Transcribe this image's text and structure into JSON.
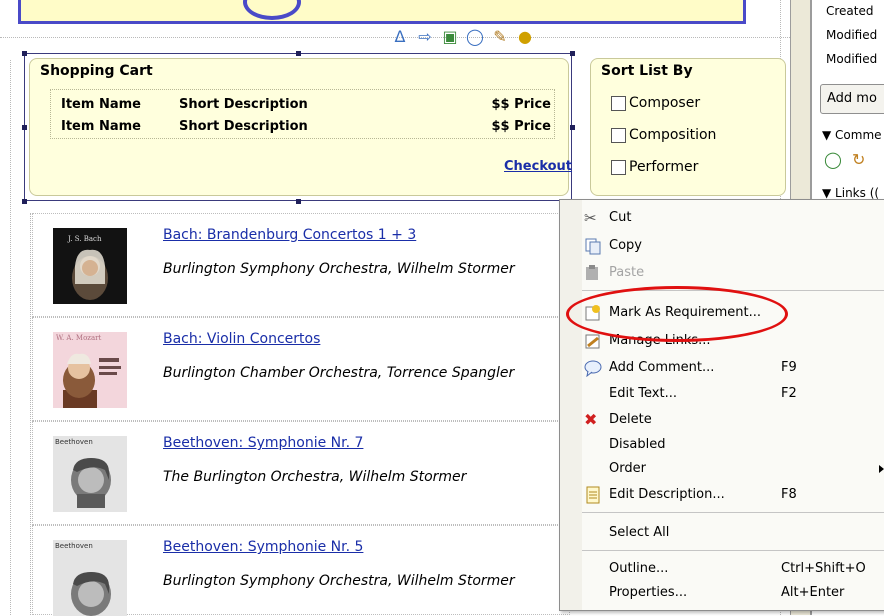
{
  "cart": {
    "title": "Shopping Cart",
    "rows": [
      {
        "name": "Item Name",
        "desc": "Short Description",
        "price": "$$ Price"
      },
      {
        "name": "Item Name",
        "desc": "Short Description",
        "price": "$$ Price"
      }
    ],
    "checkout": "Checkout"
  },
  "sort": {
    "title": "Sort List By",
    "options": [
      "Composer",
      "Composition",
      "Performer"
    ]
  },
  "products": [
    {
      "title": "Bach: Brandenburg Concertos 1 + 3",
      "subtitle": "Burlington Symphony Orchestra, Wilhelm Stormer",
      "thumb_caption": "J. S. Bach"
    },
    {
      "title": "Bach: Violin Concertos",
      "subtitle": "Burlington Chamber Orchestra, Torrence Spangler",
      "thumb_caption": "W. A. Mozart"
    },
    {
      "title": "Beethoven: Symphonie Nr. 7",
      "subtitle": "The Burlington Orchestra, Wilhelm Stormer",
      "thumb_caption": "Beethoven"
    },
    {
      "title": "Beethoven: Symphonie Nr. 5",
      "subtitle": "Burlington Symphony Orchestra, Wilhelm Stormer",
      "thumb_caption": "Beethoven"
    }
  ],
  "right_panel": {
    "created": "Created",
    "modified1": "Modified",
    "modified2": "Modified",
    "add_button": "Add mo",
    "comments_header": "Comme",
    "links_header": "Links (("
  },
  "context_menu": {
    "items": [
      {
        "label": "Cut",
        "key": "",
        "icon": "scissors-icon"
      },
      {
        "label": "Copy",
        "key": "",
        "icon": "copy-icon"
      },
      {
        "label": "Paste",
        "key": "",
        "icon": "paste-icon",
        "disabled": true
      },
      {
        "label": "Mark As Requirement...",
        "key": "",
        "icon": "requirement-icon"
      },
      {
        "label": "Manage Links...",
        "key": "",
        "icon": "link-icon"
      },
      {
        "label": "Add Comment...",
        "key": "F9",
        "icon": "comment-icon"
      },
      {
        "label": "Edit Text...",
        "key": "F2",
        "icon": ""
      },
      {
        "label": "Delete",
        "key": "",
        "icon": "delete-icon"
      },
      {
        "label": "Disabled",
        "key": "",
        "icon": ""
      },
      {
        "label": "Order",
        "key": "",
        "icon": "",
        "submenu": true
      },
      {
        "label": "Edit Description...",
        "key": "F8",
        "icon": "description-icon"
      },
      {
        "label": "Select All",
        "key": "",
        "icon": ""
      },
      {
        "label": "Outline...",
        "key": "Ctrl+Shift+O",
        "icon": ""
      },
      {
        "label": "Properties...",
        "key": "Alt+Enter",
        "icon": ""
      }
    ]
  },
  "colors": {
    "link": "#1a2ea8",
    "widget_bg": "#ffffdd",
    "annotation": "#e01010"
  }
}
